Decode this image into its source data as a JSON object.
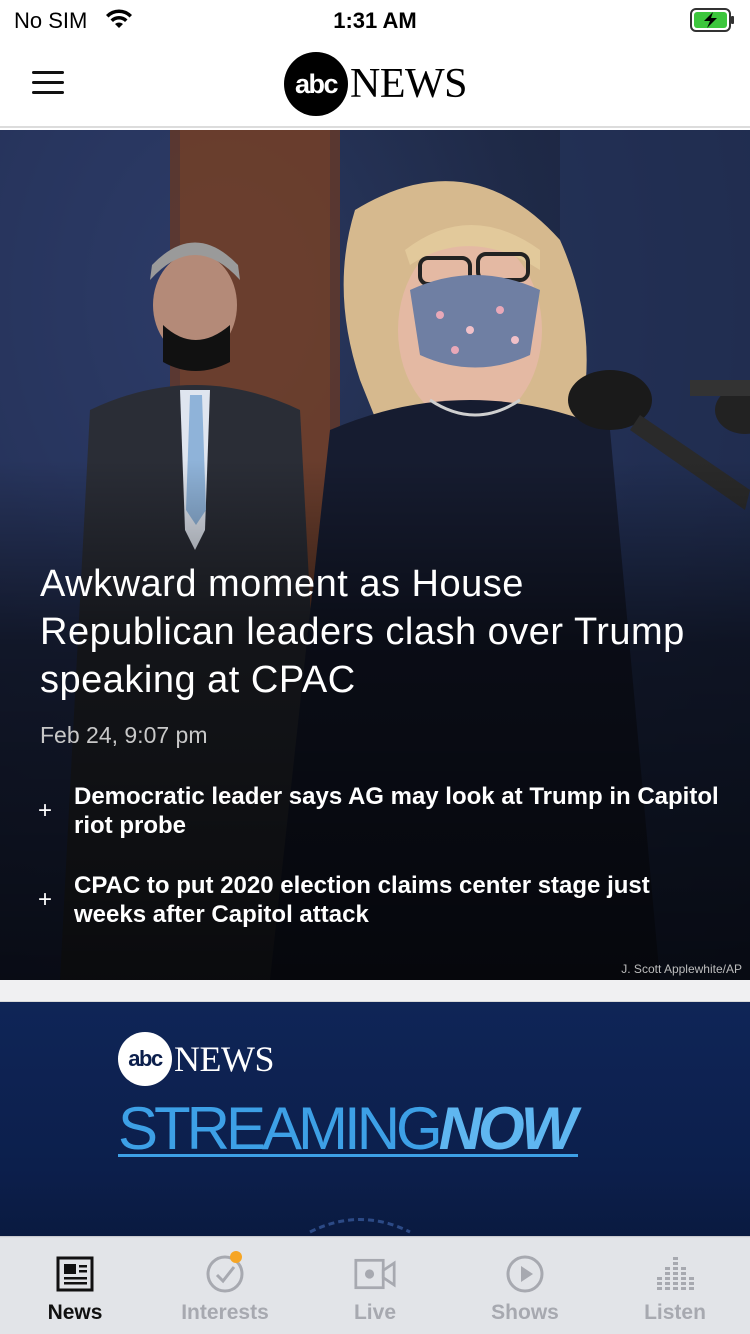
{
  "status_bar": {
    "carrier": "No SIM",
    "time": "1:31 AM"
  },
  "header": {
    "logo_abc": "abc",
    "logo_news": "NEWS"
  },
  "hero": {
    "headline": "Awkward moment as House Republican leaders clash over Trump speaking at CPAC",
    "date": "Feb 24, 9:07 pm",
    "related": [
      {
        "icon": "plus-icon",
        "text": "Democratic leader says AG may look at Trump in Capitol riot probe"
      },
      {
        "icon": "plus-icon",
        "text": "CPAC to put 2020 election claims center stage just weeks after Capitol attack"
      }
    ],
    "credit": "J. Scott Applewhite/AP"
  },
  "streaming": {
    "logo_abc": "abc",
    "logo_news": "NEWS",
    "word1": "STREAMING",
    "word2": "NOW"
  },
  "tabs": [
    {
      "label": "News",
      "icon": "newspaper-icon",
      "active": true
    },
    {
      "label": "Interests",
      "icon": "check-circle-icon",
      "active": false,
      "badge": true
    },
    {
      "label": "Live",
      "icon": "video-camera-icon",
      "active": false
    },
    {
      "label": "Shows",
      "icon": "play-circle-icon",
      "active": false
    },
    {
      "label": "Listen",
      "icon": "equalizer-icon",
      "active": false
    }
  ],
  "colors": {
    "accent_dot": "#f6a524",
    "stream_bg": "#0f2557",
    "stream_text": "#3da0e6",
    "tab_active": "#111111",
    "tab_inactive": "#a7a9b0",
    "battery_green": "#3cc63c"
  }
}
